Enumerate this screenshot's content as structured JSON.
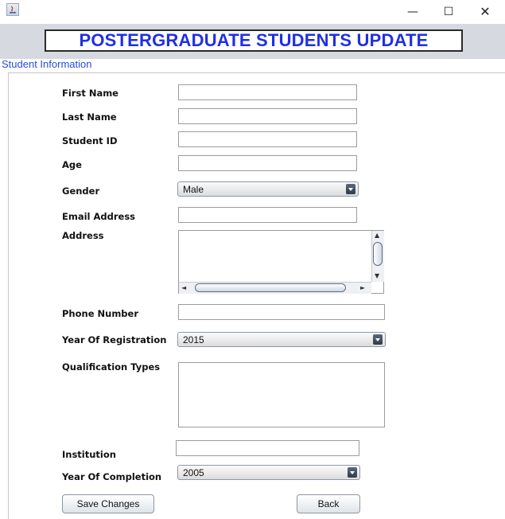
{
  "window": {
    "minimize_glyph": "—",
    "maximize_glyph": "☐",
    "close_glyph": "✕"
  },
  "header": {
    "title": "POSTERGRADUATE STUDENTS UPDATE"
  },
  "section": {
    "title": "Student Information"
  },
  "fields": {
    "first_name": {
      "label": "First Name",
      "value": ""
    },
    "last_name": {
      "label": "Last Name",
      "value": ""
    },
    "student_id": {
      "label": "Student ID",
      "value": ""
    },
    "age": {
      "label": "Age",
      "value": ""
    },
    "gender": {
      "label": "Gender",
      "selected": "Male"
    },
    "email": {
      "label": "Email Address",
      "value": ""
    },
    "address": {
      "label": "Address",
      "value": ""
    },
    "phone": {
      "label": "Phone Number",
      "value": ""
    },
    "year_registration": {
      "label": "Year Of Registration",
      "selected": "2015"
    },
    "qualification_types": {
      "label": "Qualification Types",
      "value": ""
    },
    "institution": {
      "label": "Institution",
      "value": ""
    },
    "year_completion": {
      "label": "Year Of Completion",
      "selected": "2005"
    }
  },
  "actions": {
    "save_label": "Save Changes",
    "back_label": "Back"
  },
  "colors": {
    "title_text": "#1f2fe6",
    "section_text": "#2a4bd6",
    "header_strip": "#d6d9df"
  }
}
